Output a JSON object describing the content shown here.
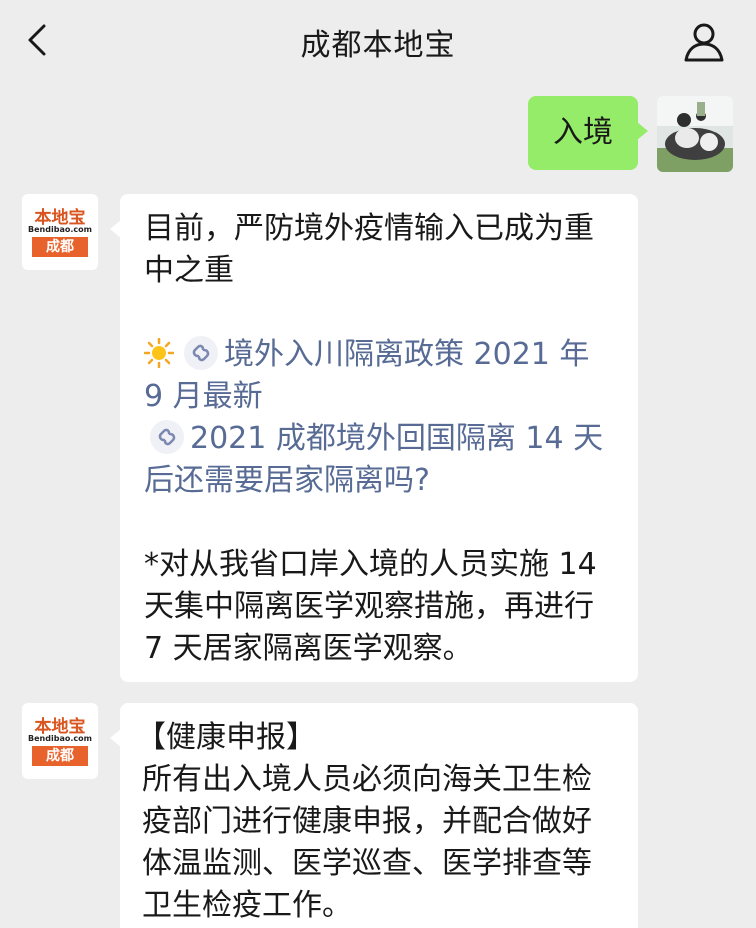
{
  "header": {
    "title": "成都本地宝"
  },
  "messages": {
    "outgoing": {
      "text": "入境"
    },
    "bot_avatar": {
      "line1": "本地宝",
      "line2": "Bendibao.com",
      "line3": "成都"
    },
    "reply1": {
      "intro_line1": "目前，严防境外疫情输入已成为重",
      "intro_line2": "中之重",
      "link1_line1": "境外入川隔离政策 2021 年",
      "link1_line2": "9 月最新",
      "link2_line1": "2021 成都境外回国隔离 14 天",
      "link2_line2": "后还需要居家隔离吗?",
      "note_line1": "*对从我省口岸入境的人员实施 14",
      "note_line2": "天集中隔离医学观察措施，再进行",
      "note_line3": "7 天居家隔离医学观察。"
    },
    "reply2": {
      "heading": "【健康申报】",
      "line1": "所有出入境人员必须向海关卫生检",
      "line2": "疫部门进行健康申报，并配合做好",
      "line3": "体温监测、医学巡查、医学排查等",
      "line4": "卫生检疫工作。"
    }
  },
  "colors": {
    "background": "#ededed",
    "outgoing_bubble": "#95ec69",
    "incoming_bubble": "#ffffff",
    "link": "#576b95",
    "logo_orange": "#e8632b"
  },
  "icons": {
    "back": "chevron-left-icon",
    "profile": "person-icon",
    "sun": "sun-emoji-icon",
    "link": "mini-program-link-icon"
  }
}
